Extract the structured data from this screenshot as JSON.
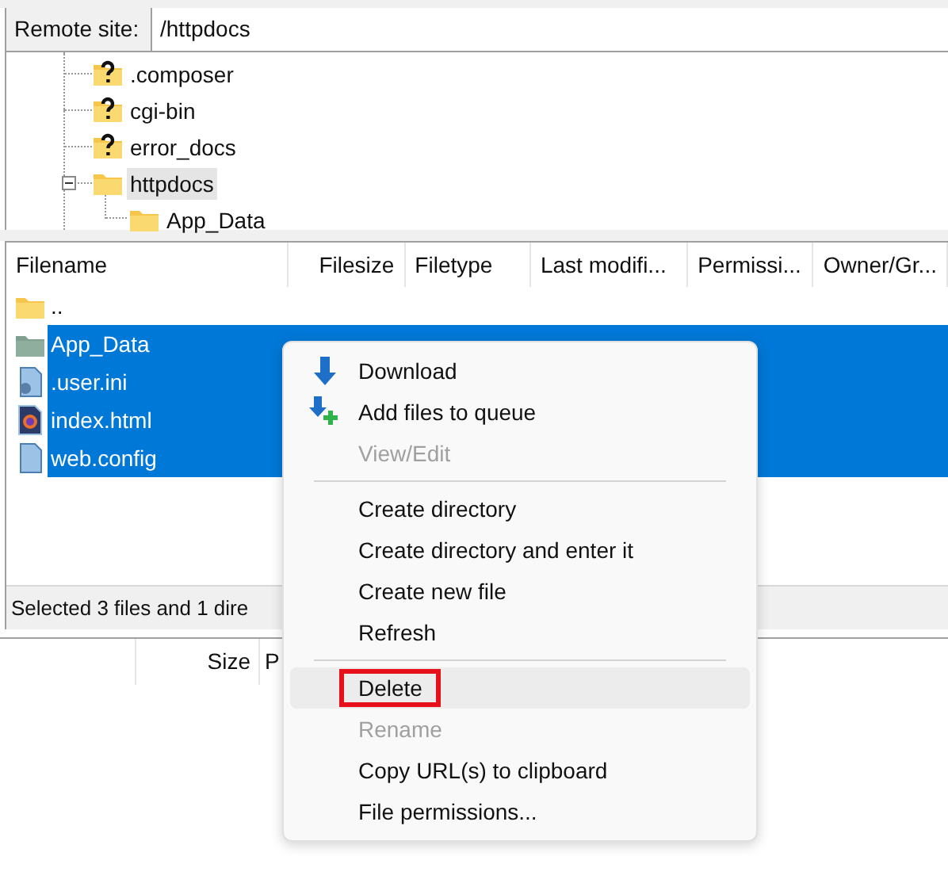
{
  "remote_site": {
    "label": "Remote site:",
    "value": "/httpdocs"
  },
  "tree": [
    {
      "name": ".composer",
      "kind": "unknown",
      "selected": false
    },
    {
      "name": "cgi-bin",
      "kind": "unknown",
      "selected": false
    },
    {
      "name": "error_docs",
      "kind": "unknown",
      "selected": false
    },
    {
      "name": "httpdocs",
      "kind": "folder",
      "selected": true,
      "expanded": true,
      "children": [
        {
          "name": "App_Data",
          "kind": "folder",
          "selected": false
        }
      ]
    }
  ],
  "file_list": {
    "columns": [
      "Filename",
      "Filesize",
      "Filetype",
      "Last modifi...",
      "Permissi...",
      "Owner/Gr..."
    ],
    "rows": [
      {
        "name": "..",
        "kind": "folder",
        "selected": false
      },
      {
        "name": "App_Data",
        "kind": "folder-dark",
        "selected": true
      },
      {
        "name": ".user.ini",
        "kind": "config",
        "selected": true
      },
      {
        "name": "index.html",
        "kind": "html",
        "selected": true
      },
      {
        "name": "web.config",
        "kind": "file",
        "selected": true
      }
    ],
    "status": "Selected 3 files and 1 dire"
  },
  "queue": {
    "columns": [
      "Size",
      "P"
    ]
  },
  "context_menu": [
    {
      "kind": "item",
      "label": "Download",
      "disabled": false,
      "highlighted": false
    },
    {
      "kind": "item",
      "label": "Add files to queue",
      "disabled": false,
      "highlighted": false
    },
    {
      "kind": "item",
      "label": "View/Edit",
      "disabled": true,
      "highlighted": false
    },
    {
      "kind": "separator"
    },
    {
      "kind": "item",
      "label": "Create directory",
      "disabled": false,
      "highlighted": false
    },
    {
      "kind": "item",
      "label": "Create directory and enter it",
      "disabled": false,
      "highlighted": false
    },
    {
      "kind": "item",
      "label": "Create new file",
      "disabled": false,
      "highlighted": false
    },
    {
      "kind": "item",
      "label": "Refresh",
      "disabled": false,
      "highlighted": false
    },
    {
      "kind": "separator"
    },
    {
      "kind": "item",
      "label": "Delete",
      "disabled": false,
      "highlighted": true
    },
    {
      "kind": "item",
      "label": "Rename",
      "disabled": true,
      "highlighted": false
    },
    {
      "kind": "item",
      "label": "Copy URL(s) to clipboard",
      "disabled": false,
      "highlighted": false
    },
    {
      "kind": "item",
      "label": "File permissions...",
      "disabled": false,
      "highlighted": false
    }
  ]
}
